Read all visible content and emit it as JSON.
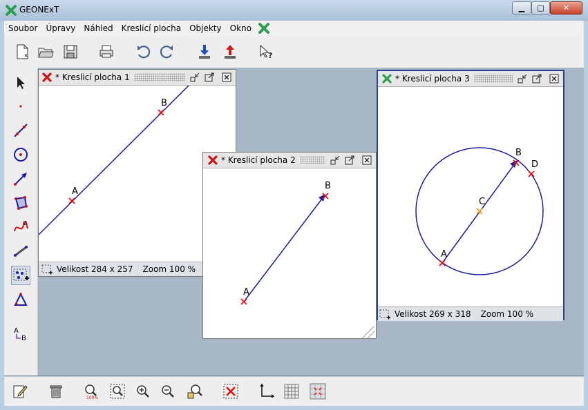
{
  "app": {
    "title": "GEONExT"
  },
  "window_controls": {
    "minimize": "▁",
    "maximize": "□",
    "close": "✕"
  },
  "menu": {
    "items": [
      "Soubor",
      "Úpravy",
      "Náhled",
      "Kreslicí plocha",
      "Objekty",
      "Okno"
    ]
  },
  "frames": {
    "f1": {
      "title": "* Kreslicí plocha 1",
      "status_size": "Velikost 284 x 257",
      "status_zoom": "Zoom 100 %",
      "points": {
        "A": "A",
        "B": "B"
      }
    },
    "f2": {
      "title": "* Kreslicí plocha 2",
      "points": {
        "A": "A",
        "B": "B"
      }
    },
    "f3": {
      "title": "* Kreslicí plocha 3",
      "status_size": "Velikost 269 x 318",
      "status_zoom": "Zoom 100 %",
      "points": {
        "A": "A",
        "B": "B",
        "C": "C",
        "D": "D"
      }
    }
  },
  "colors": {
    "accent_blue": "#1a1aa8",
    "point_red": "#e01010",
    "point_orange": "#f0a020",
    "active_frame_border": "#2c3f8f",
    "logo_green": "#2e9e4e"
  },
  "icons": {
    "toolbar": [
      "new-document-icon",
      "open-folder-icon",
      "save-icon",
      "print-icon",
      "undo-icon",
      "redo-icon",
      "import-icon",
      "export-icon",
      "help-pointer-icon"
    ],
    "left": [
      "select-arrow-icon",
      "point-icon",
      "line-icon",
      "circle-icon",
      "vector-icon",
      "polygon-icon",
      "curve-icon",
      "measure-icon",
      "group-points-icon",
      "angle-icon",
      "label-icon"
    ],
    "bottom": [
      "edit-icon",
      "trash-icon",
      "zoom-100-icon",
      "zoom-fit-icon",
      "zoom-in-icon",
      "zoom-out-icon",
      "zoom-box-icon",
      "delete-selection-icon",
      "axes-icon",
      "grid-icon",
      "snap-grid-icon"
    ]
  }
}
